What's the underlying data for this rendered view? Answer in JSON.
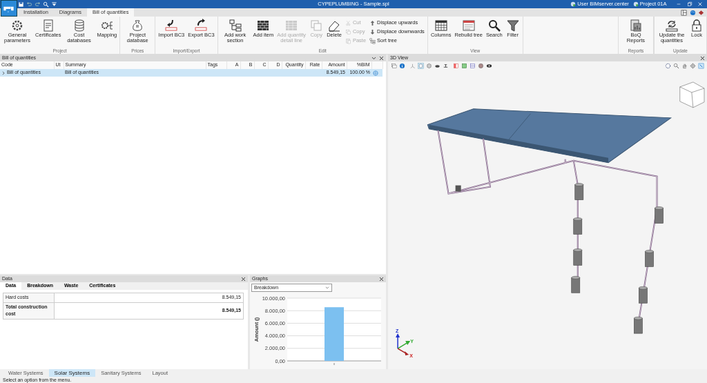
{
  "title_bar": {
    "title": "CYPEPLUMBING - Sample.spl",
    "user": "User BIMserver.center",
    "project": "Project 01A"
  },
  "tabs": [
    {
      "label": "Installation",
      "selected": false
    },
    {
      "label": "Diagrams",
      "selected": false
    },
    {
      "label": "Bill of quantities",
      "selected": true
    }
  ],
  "ribbon": {
    "groups": [
      {
        "label": "Project",
        "buttons": [
          {
            "label": "General parameters",
            "disabled": false
          },
          {
            "label": "Certificates",
            "disabled": false
          },
          {
            "label": "Cost databases",
            "disabled": false
          },
          {
            "label": "Mapping",
            "disabled": false
          }
        ]
      },
      {
        "label": "Prices",
        "buttons": [
          {
            "label": "Project database",
            "disabled": false
          }
        ]
      },
      {
        "label": "Import/Export",
        "buttons": [
          {
            "label": "Import BC3",
            "disabled": false
          },
          {
            "label": "Export BC3",
            "disabled": false
          }
        ]
      },
      {
        "label": "Edit",
        "buttons": [
          {
            "label": "Add work section",
            "disabled": false
          },
          {
            "label": "Add item",
            "disabled": false
          },
          {
            "label": "Add quantity detail line",
            "disabled": true
          },
          {
            "label": "Copy",
            "disabled": true
          },
          {
            "label": "Delete",
            "disabled": false
          }
        ],
        "small_buttons": [
          {
            "label": "Cut",
            "disabled": true
          },
          {
            "label": "Copy",
            "disabled": true
          },
          {
            "label": "Paste",
            "disabled": true
          },
          {
            "label": "Displace upwards",
            "disabled": false
          },
          {
            "label": "Displace downwards",
            "disabled": false
          },
          {
            "label": "Sort tree",
            "disabled": false
          }
        ]
      },
      {
        "label": "View",
        "buttons": [
          {
            "label": "Columns",
            "disabled": false
          },
          {
            "label": "Rebuild tree",
            "disabled": false
          },
          {
            "label": "Search",
            "disabled": false
          },
          {
            "label": "Filter",
            "disabled": false
          }
        ]
      }
    ],
    "right_groups": [
      {
        "label": "Reports",
        "buttons": [
          {
            "label": "BoQ Reports",
            "disabled": false
          }
        ]
      },
      {
        "label": "Update",
        "buttons": [
          {
            "label": "Update the quantities",
            "disabled": false
          },
          {
            "label": "Lock",
            "disabled": false
          }
        ]
      }
    ]
  },
  "bill_of_quantities": {
    "title": "Bill of quantities",
    "columns": [
      "Code",
      "Ut",
      "Summary",
      "Tags",
      "A",
      "B",
      "C",
      "D",
      "Quantity",
      "Rate",
      "Amount",
      "%BIM"
    ],
    "rows": [
      {
        "selected": true,
        "expanded": false,
        "cells": [
          "Bill of quantities",
          "",
          "Bill of quantities",
          "",
          "",
          "",
          "",
          "",
          "",
          "",
          "8.549,15",
          "100.00 %"
        ]
      }
    ]
  },
  "data_panel": {
    "title": "Data",
    "tabs": [
      {
        "label": "Data",
        "selected": true
      },
      {
        "label": "Breakdown",
        "selected": false
      },
      {
        "label": "Waste",
        "selected": false
      },
      {
        "label": "Certificates",
        "selected": false
      }
    ],
    "rows": [
      {
        "label": "Hard costs",
        "value": "8.549,15",
        "total": false
      },
      {
        "label": "Total construction cost",
        "value": "8.549,15",
        "total": true
      }
    ]
  },
  "graphs_panel": {
    "title": "Graphs",
    "selector": "Breakdown",
    "chart_data": {
      "type": "bar",
      "ylabel": "Amount ()",
      "values": [
        8550
      ],
      "ylim": [
        0,
        10000
      ],
      "grid": true,
      "yticks": [
        {
          "value": 0,
          "label": "0,00"
        },
        {
          "value": 2000,
          "label": "2.000,00"
        },
        {
          "value": 4000,
          "label": "4.000,00"
        },
        {
          "value": 6000,
          "label": "6.000,00"
        },
        {
          "value": 8000,
          "label": "8.000,00"
        },
        {
          "value": 10000,
          "label": "10.000,00"
        }
      ]
    }
  },
  "view_3d": {
    "title": "3D View",
    "axes": [
      "Z",
      "Y",
      "X"
    ]
  },
  "bottom_tabs": [
    {
      "label": "Water Systems",
      "selected": false
    },
    {
      "label": "Solar Systems",
      "selected": true
    },
    {
      "label": "Sanitary Systems",
      "selected": false
    },
    {
      "label": "Layout",
      "selected": false
    }
  ],
  "status_bar": "Select an option from the menu."
}
